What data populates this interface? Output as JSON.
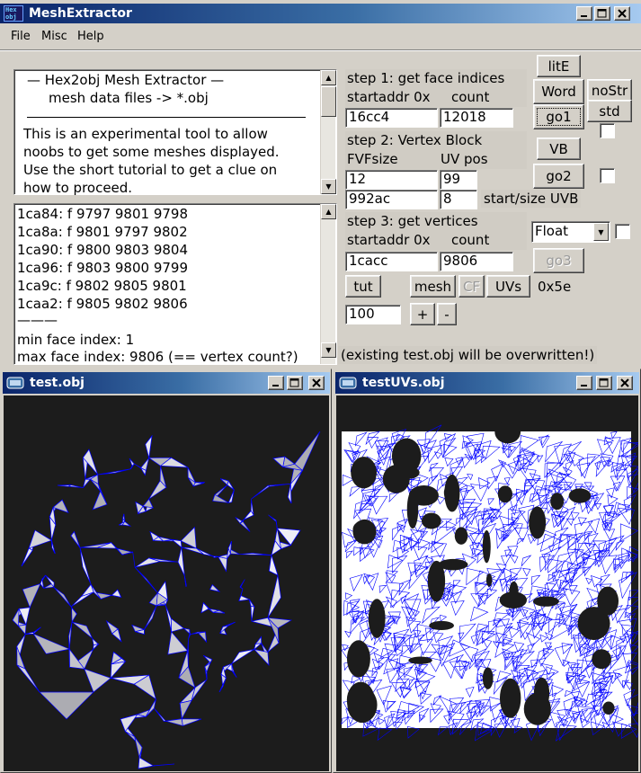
{
  "app": {
    "title": "MeshExtractor",
    "icon_text_top": "Hex",
    "icon_text_bottom": "obj"
  },
  "menu": {
    "file": "File",
    "misc": "Misc",
    "help": "Help"
  },
  "info": {
    "line1": "—   Hex2obj Mesh Extractor   —",
    "line2": "mesh data files -> *.obj",
    "rule": "—————————————————————",
    "body1": "This is an experimental tool to allow",
    "body2": "noobs to get some meshes displayed.",
    "body3": "Use the short tutorial to get a clue on",
    "body4": "how to proceed."
  },
  "log": {
    "rows": [
      "1ca84: f  9797 9801 9798",
      "1ca8a: f  9801 9797 9802",
      "1ca90: f  9800 9803 9804",
      "1ca96: f  9803 9800 9799",
      "1ca9c: f  9802 9805 9801",
      "1caa2: f  9805 9802 9806"
    ],
    "separator": "———",
    "min": "min face index: 1",
    "max": "max face index: 9806 (== vertex count?)"
  },
  "step1": {
    "title": "step 1: get face indices",
    "label_start": "startaddr 0x",
    "label_count": "count",
    "startaddr": "16cc4",
    "count": "12018"
  },
  "step2": {
    "title": "step 2: Vertex Block",
    "label_fvf": "FVFsize",
    "label_uv": "UV pos",
    "fvfsize": "12",
    "uvpos": "99",
    "uvb_start": "992ac",
    "uvb_size": "8",
    "uvb_label": "start/size UVB"
  },
  "step3": {
    "title": "step 3: get vertices",
    "label_start": "startaddr 0x",
    "label_count": "count",
    "startaddr": "1cacc",
    "count": "9806",
    "format_selected": "Float"
  },
  "buttons": {
    "lite": "litE",
    "word": "Word",
    "nostr": "noStr",
    "std": "std",
    "go1": "go1",
    "vb": "VB",
    "go2": "go2",
    "go3": "go3",
    "tut": "tut",
    "mesh": "mesh",
    "cf": "CF",
    "uvs": "UVs",
    "hex_value": "0x5e",
    "plus": "+",
    "minus": "-",
    "scale_value": "100"
  },
  "warning": "(existing test.obj will be overwritten!)",
  "windows": {
    "left_title": "test.obj",
    "right_title": "testUVs.obj"
  },
  "colors": {
    "title_active": "#0a246a",
    "wire": "#0000ff",
    "mesh_fill": "#c8c8cc",
    "viewport_bg": "#1c1c1c"
  }
}
